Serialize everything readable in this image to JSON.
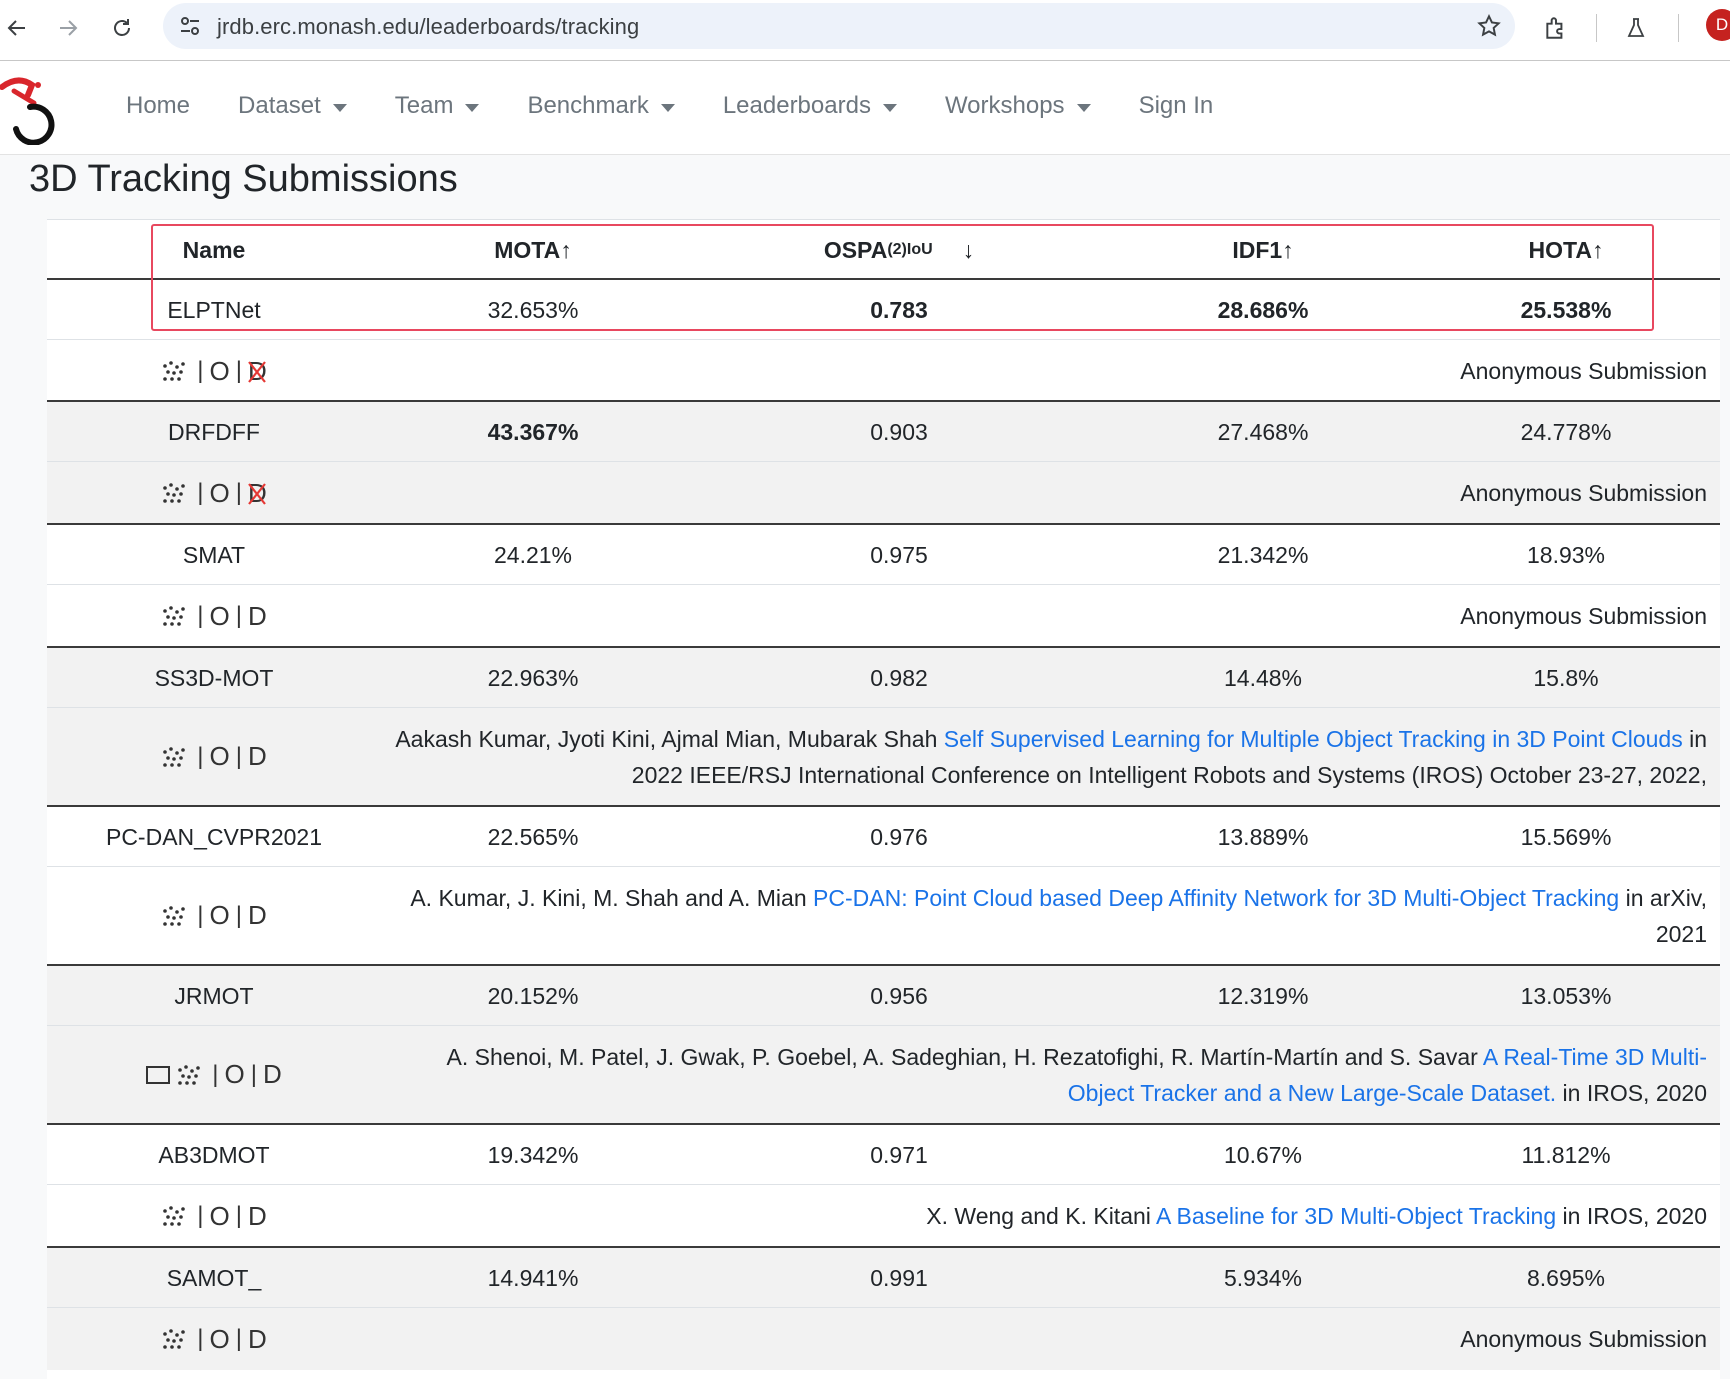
{
  "browser": {
    "url": "jrdb.erc.monash.edu/leaderboards/tracking",
    "profile_initial": "D"
  },
  "navbar": {
    "items": [
      {
        "label": "Home"
      },
      {
        "label": "Dataset"
      },
      {
        "label": "Team"
      },
      {
        "label": "Benchmark"
      },
      {
        "label": "Leaderboards"
      },
      {
        "label": "Workshops"
      },
      {
        "label": "Sign In"
      }
    ]
  },
  "page": {
    "title": "3D Tracking Submissions"
  },
  "table": {
    "headers": {
      "name": "Name",
      "mota": "MOTA↑",
      "ospa_main": "OSPA",
      "ospa_sup": "(2)",
      "ospa_sub": "IoU",
      "ospa_arrow": "↓",
      "idf1": "IDF1↑",
      "hota": "HOTA↑"
    },
    "modality": {
      "sep": "|",
      "O": "O",
      "D": "D"
    },
    "rows": [
      {
        "name": "ELPTNet",
        "mota": "32.653%",
        "ospa": "0.783",
        "idf1": "28.686%",
        "hota": "25.538%",
        "reference": "Anonymous Submission"
      },
      {
        "name": "DRFDFF",
        "mota": "43.367%",
        "ospa": "0.903",
        "idf1": "27.468%",
        "hota": "24.778%",
        "reference": "Anonymous Submission"
      },
      {
        "name": "SMAT",
        "mota": "24.21%",
        "ospa": "0.975",
        "idf1": "21.342%",
        "hota": "18.93%",
        "reference": "Anonymous Submission"
      },
      {
        "name": "SS3D-MOT",
        "mota": "22.963%",
        "ospa": "0.982",
        "idf1": "14.48%",
        "hota": "15.8%",
        "ref_authors": "Aakash Kumar, Jyoti Kini, Ajmal Mian, Mubarak Shah",
        "ref_title": "Self Supervised Learning for Multiple Object Tracking in 3D Point Clouds",
        "ref_venue": "in 2022 IEEE/RSJ International Conference on Intelligent Robots and Systems (IROS) October 23-27, 2022,"
      },
      {
        "name": "PC-DAN_CVPR2021",
        "mota": "22.565%",
        "ospa": "0.976",
        "idf1": "13.889%",
        "hota": "15.569%",
        "ref_authors": "A. Kumar, J. Kini, M. Shah and A. Mian",
        "ref_title": "PC-DAN: Point Cloud based Deep Affinity Network for 3D Multi-Object Tracking",
        "ref_venue": "in arXiv, 2021"
      },
      {
        "name": "JRMOT",
        "mota": "20.152%",
        "ospa": "0.956",
        "idf1": "12.319%",
        "hota": "13.053%",
        "ref_authors": "A. Shenoi, M. Patel, J. Gwak, P. Goebel, A. Sadeghian, H. Rezatofighi, R. Martín-Martín and S. Savar",
        "ref_title": "A Real-Time 3D Multi-Object Tracker and a New Large-Scale Dataset.",
        "ref_venue": "in IROS, 2020"
      },
      {
        "name": "AB3DMOT",
        "mota": "19.342%",
        "ospa": "0.971",
        "idf1": "10.67%",
        "hota": "11.812%",
        "ref_authors": "X. Weng and K. Kitani",
        "ref_title": "A Baseline for 3D Multi-Object Tracking",
        "ref_venue": "in IROS, 2020"
      },
      {
        "name": "SAMOT_",
        "mota": "14.941%",
        "ospa": "0.991",
        "idf1": "5.934%",
        "hota": "8.695%",
        "reference": "Anonymous Submission"
      }
    ]
  }
}
